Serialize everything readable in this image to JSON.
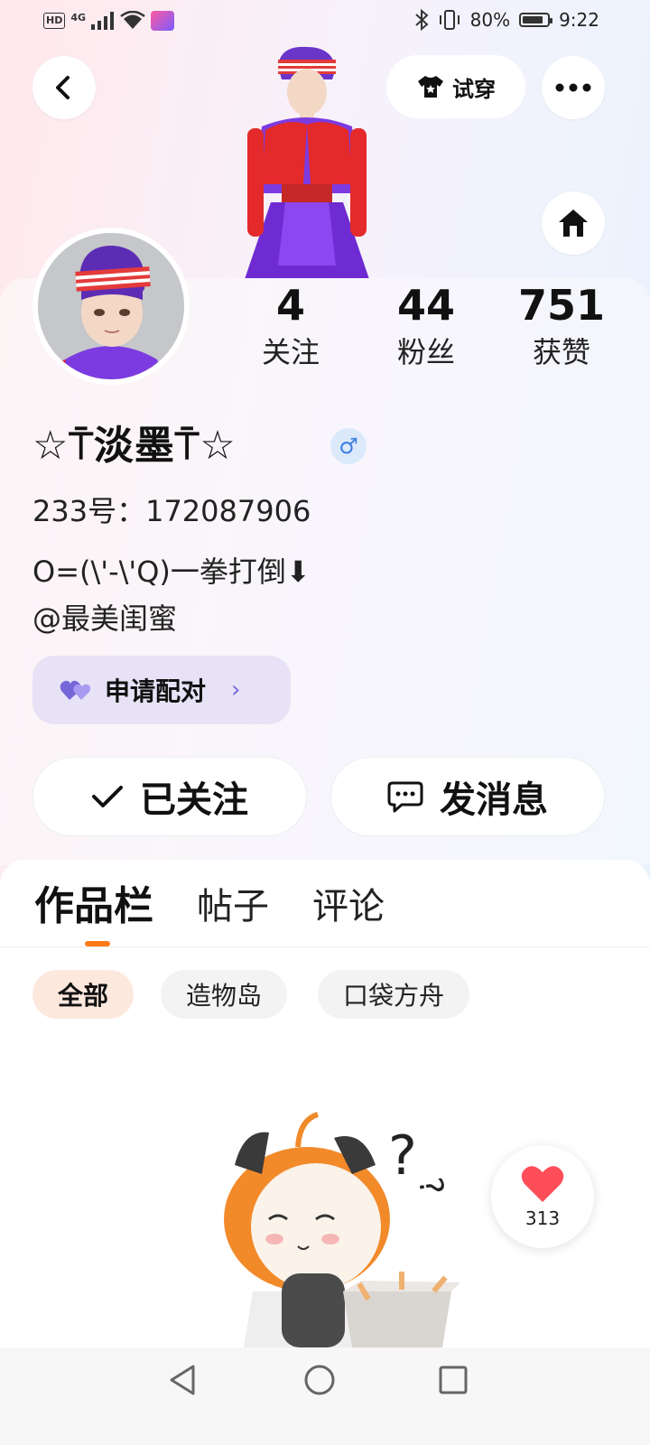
{
  "status_bar": {
    "network_label": "HD",
    "signal_label": "4G",
    "battery_percent": "80%",
    "time": "9:22"
  },
  "header": {
    "tryon_label": "试穿"
  },
  "profile": {
    "stats": [
      {
        "value": "4",
        "label": "关注"
      },
      {
        "value": "44",
        "label": "粉丝"
      },
      {
        "value": "751",
        "label": "获赞"
      }
    ],
    "nickname": "☆⍑淡墨⍑☆",
    "gender_symbol": "♂",
    "uid": "233号：172087906",
    "bio_line1": "O=(\\'-\\'Q)一拳打倒⬇",
    "bio_line2": "@最美闺蜜",
    "pair_label": "申请配对"
  },
  "actions": {
    "follow_label": "已关注",
    "message_label": "发消息"
  },
  "content": {
    "tabs": [
      "作品栏",
      "帖子",
      "评论"
    ],
    "filters": [
      "全部",
      "造物岛",
      "口袋方舟"
    ],
    "like_count": "313"
  },
  "colors": {
    "accent_orange": "#ff7a1a",
    "pair_purple": "#7667d9",
    "gender_blue": "#3d7fe0"
  }
}
